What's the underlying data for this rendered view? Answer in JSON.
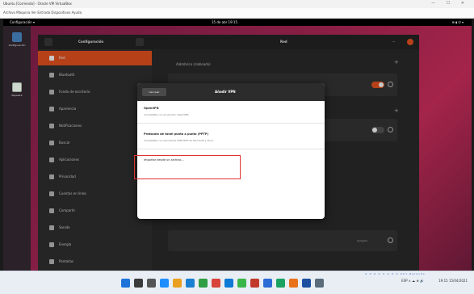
{
  "host": {
    "title": "Ubuntu [Corriendo] - Oracle VM VirtualBox",
    "menu": "Archivo  Máquina  Ver  Entrada  Dispositivos  Ayuda",
    "controls": "— ☐ ✕"
  },
  "ubuntu": {
    "activities": "Configuración ▾",
    "clock": "15 de abr  19:15",
    "tray": "⊞ ◖ ⏻ ▾"
  },
  "dock": {
    "items": [
      {
        "label": "Configuración"
      },
      {
        "label": "Papelera"
      }
    ]
  },
  "settings": {
    "title": "Configuración",
    "panel_title": "Red",
    "sidebar": [
      {
        "label": "Red"
      },
      {
        "label": "Bluetooth"
      },
      {
        "label": "Fondo de escritorio"
      },
      {
        "label": "Apariencia"
      },
      {
        "label": "Notificaciones"
      },
      {
        "label": "Buscar"
      },
      {
        "label": "Aplicaciones"
      },
      {
        "label": "Privacidad"
      },
      {
        "label": "Cuentas en línea"
      },
      {
        "label": "Compartir"
      },
      {
        "label": "Sonido"
      },
      {
        "label": "Energía"
      },
      {
        "label": "Pantallas"
      }
    ],
    "wired_header": "Alámbrico (cableado)",
    "proxy_label": "Apagado"
  },
  "dialog": {
    "cancel": "Cancelar",
    "title": "Añadir VPN",
    "options": [
      {
        "title": "OpenVPN",
        "desc": "Compatible con el servidor OpenVPN."
      },
      {
        "title": "Protocolo de túnel punto a punto (PPTP)",
        "desc": "Compatible con servidores VPN PPTP de Microsoft y otros."
      },
      {
        "title": "Importar desde un archivo…",
        "desc": ""
      }
    ]
  },
  "taskbar": {
    "clock": "19:15 15/04/2021",
    "tray": "ESP ∧ ☁ ⊕ 🔊",
    "vbox_indicators": "⊙ ⊙ ⊙ ⊙ ⊙ ⊙ ⊙ ⊙ Ctrl Derecho"
  },
  "colors": {
    "accent": "#e95420",
    "highlight_box": "#e0322f"
  }
}
